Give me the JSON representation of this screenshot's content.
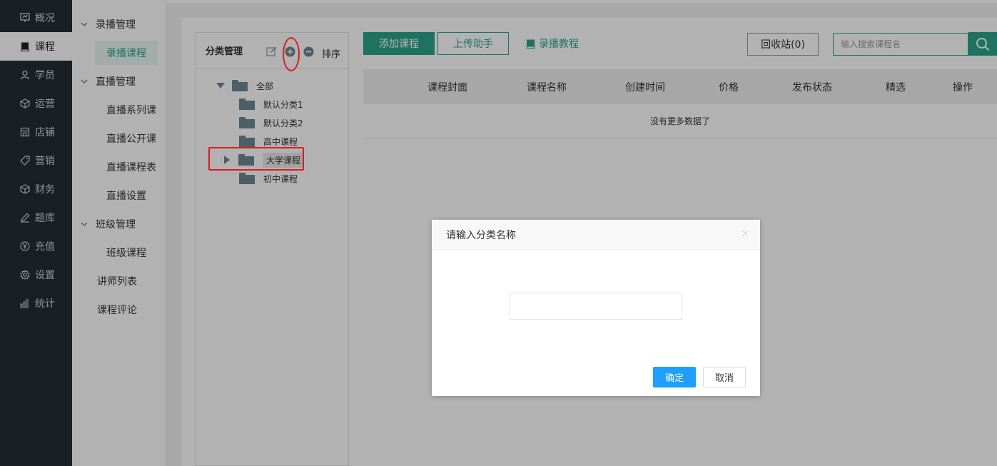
{
  "nav": {
    "items": [
      {
        "label": "概况",
        "icon": "monitor-icon"
      },
      {
        "label": "课程",
        "icon": "book-icon",
        "active": true
      },
      {
        "label": "学员",
        "icon": "user-icon"
      },
      {
        "label": "运营",
        "icon": "cube-icon"
      },
      {
        "label": "店铺",
        "icon": "store-icon"
      },
      {
        "label": "营销",
        "icon": "tag-icon"
      },
      {
        "label": "财务",
        "icon": "cube-icon"
      },
      {
        "label": "题库",
        "icon": "pen-icon"
      },
      {
        "label": "充值",
        "icon": "yen-icon"
      },
      {
        "label": "设置",
        "icon": "gear-icon"
      },
      {
        "label": "统计",
        "icon": "bar-chart-icon"
      }
    ]
  },
  "submenu": {
    "recorded_group": "录播管理",
    "recorded_course": "录播课程",
    "live_group": "直播管理",
    "live_series": "直播系列课",
    "live_open": "直播公开课",
    "live_schedule": "直播课程表",
    "live_settings": "直播设置",
    "class_group": "班级管理",
    "class_course": "班级课程",
    "teacher_list": "讲师列表",
    "course_reviews": "课程评论"
  },
  "category": {
    "title": "分类管理",
    "sort_label": "排序",
    "tree": {
      "all": "全部",
      "items": [
        "默认分类1",
        "默认分类2",
        "高中课程",
        "大学课程",
        "初中课程"
      ]
    }
  },
  "toolbar": {
    "add_course": "添加课程",
    "upload_helper": "上传助手",
    "tutorial": "录播教程",
    "recycle_bin": "回收站(0)",
    "search_placeholder": "输入搜索课程名"
  },
  "table": {
    "headers": [
      "课程封面",
      "课程名称",
      "创建时间",
      "价格",
      "发布状态",
      "精选",
      "操作"
    ],
    "empty_text": "没有更多数据了"
  },
  "dialog": {
    "title": "请输入分类名称",
    "input_value": "",
    "ok_label": "确定",
    "cancel_label": "取消"
  },
  "colors": {
    "accent": "#2aa58a",
    "nav_bg": "#252d31",
    "dialog_ok": "#1e9fff",
    "annotation_red": "#e01b1b"
  }
}
